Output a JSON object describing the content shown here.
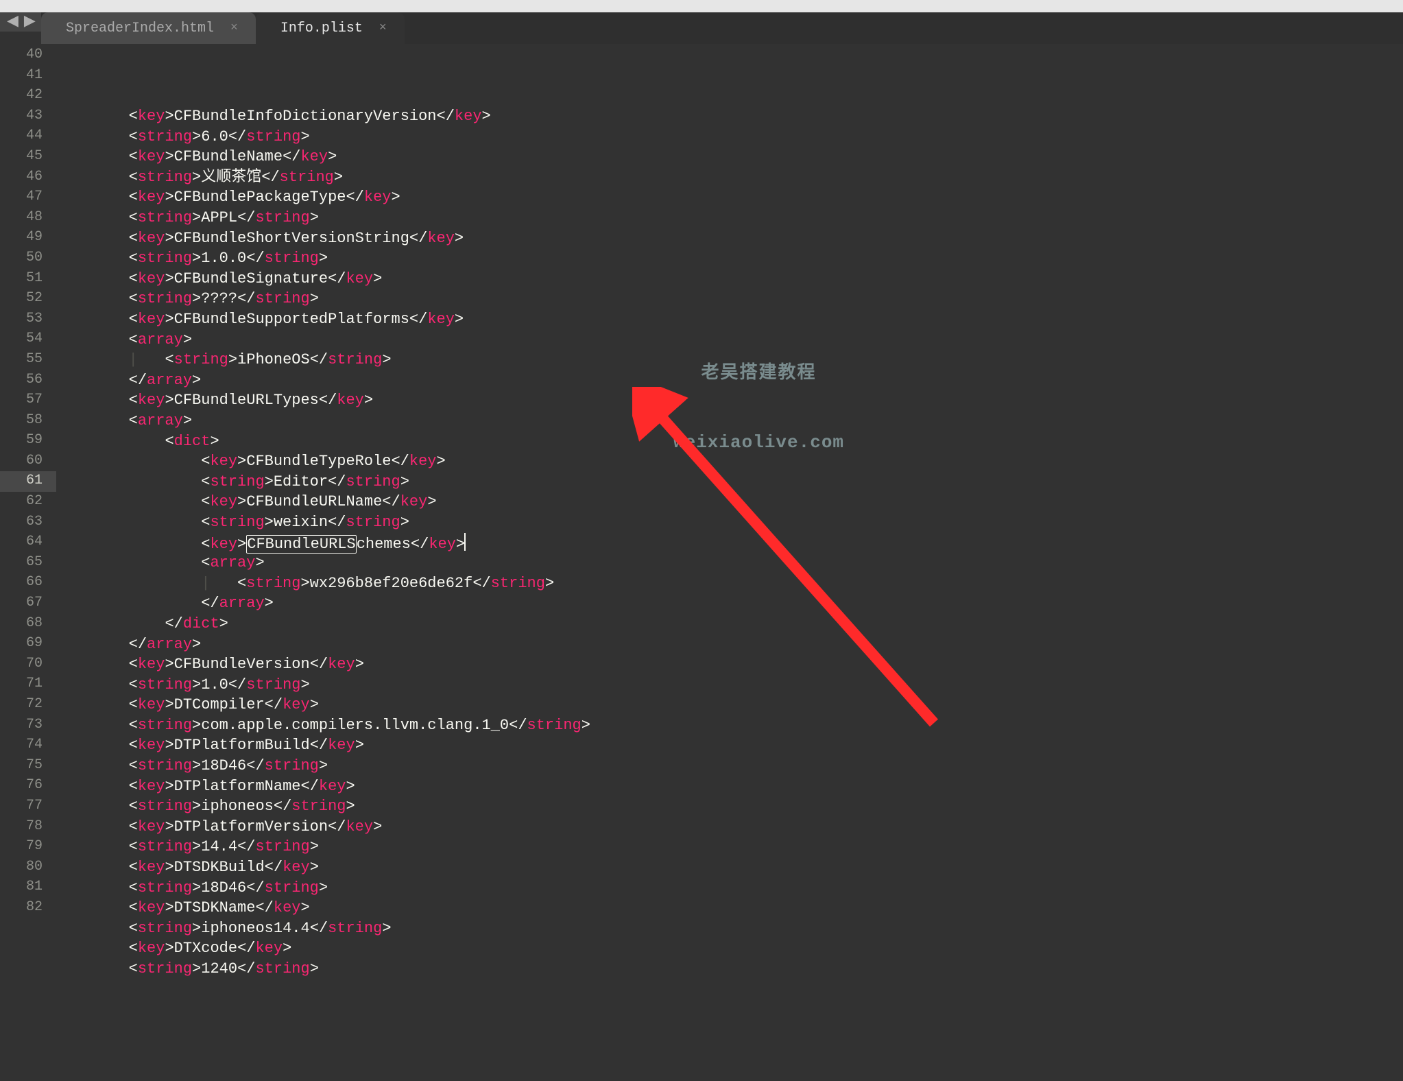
{
  "tabs": [
    {
      "label": "SpreaderIndex.html",
      "active": false
    },
    {
      "label": "Info.plist",
      "active": true
    }
  ],
  "watermark": {
    "line1": "老吴搭建教程",
    "line2": "weixiaolive.com"
  },
  "gutter": {
    "start": 40,
    "end": 82,
    "highlight": 61
  },
  "boxed_text": "CFBundleURLS",
  "lines": [
    {
      "n": 40,
      "indent": 2,
      "tokens": [
        [
          "p",
          "<"
        ],
        [
          "t",
          "key"
        ],
        [
          "p",
          ">"
        ],
        [
          "tx",
          "CFBundleInfoDictionaryVersion"
        ],
        [
          "p",
          "</"
        ],
        [
          "t",
          "key"
        ],
        [
          "p",
          ">"
        ]
      ]
    },
    {
      "n": 41,
      "indent": 2,
      "tokens": [
        [
          "p",
          "<"
        ],
        [
          "t",
          "string"
        ],
        [
          "p",
          ">"
        ],
        [
          "tx",
          "6.0"
        ],
        [
          "p",
          "</"
        ],
        [
          "t",
          "string"
        ],
        [
          "p",
          ">"
        ]
      ]
    },
    {
      "n": 42,
      "indent": 2,
      "tokens": [
        [
          "p",
          "<"
        ],
        [
          "t",
          "key"
        ],
        [
          "p",
          ">"
        ],
        [
          "tx",
          "CFBundleName"
        ],
        [
          "p",
          "</"
        ],
        [
          "t",
          "key"
        ],
        [
          "p",
          ">"
        ]
      ]
    },
    {
      "n": 43,
      "indent": 2,
      "tokens": [
        [
          "p",
          "<"
        ],
        [
          "t",
          "string"
        ],
        [
          "p",
          ">"
        ],
        [
          "tx",
          "义顺茶馆"
        ],
        [
          "p",
          "</"
        ],
        [
          "t",
          "string"
        ],
        [
          "p",
          ">"
        ]
      ]
    },
    {
      "n": 44,
      "indent": 2,
      "tokens": [
        [
          "p",
          "<"
        ],
        [
          "t",
          "key"
        ],
        [
          "p",
          ">"
        ],
        [
          "tx",
          "CFBundlePackageType"
        ],
        [
          "p",
          "</"
        ],
        [
          "t",
          "key"
        ],
        [
          "p",
          ">"
        ]
      ]
    },
    {
      "n": 45,
      "indent": 2,
      "tokens": [
        [
          "p",
          "<"
        ],
        [
          "t",
          "string"
        ],
        [
          "p",
          ">"
        ],
        [
          "tx",
          "APPL"
        ],
        [
          "p",
          "</"
        ],
        [
          "t",
          "string"
        ],
        [
          "p",
          ">"
        ]
      ]
    },
    {
      "n": 46,
      "indent": 2,
      "tokens": [
        [
          "p",
          "<"
        ],
        [
          "t",
          "key"
        ],
        [
          "p",
          ">"
        ],
        [
          "tx",
          "CFBundleShortVersionString"
        ],
        [
          "p",
          "</"
        ],
        [
          "t",
          "key"
        ],
        [
          "p",
          ">"
        ]
      ]
    },
    {
      "n": 47,
      "indent": 2,
      "tokens": [
        [
          "p",
          "<"
        ],
        [
          "t",
          "string"
        ],
        [
          "p",
          ">"
        ],
        [
          "tx",
          "1.0.0"
        ],
        [
          "p",
          "</"
        ],
        [
          "t",
          "string"
        ],
        [
          "p",
          ">"
        ]
      ]
    },
    {
      "n": 48,
      "indent": 2,
      "tokens": [
        [
          "p",
          "<"
        ],
        [
          "t",
          "key"
        ],
        [
          "p",
          ">"
        ],
        [
          "tx",
          "CFBundleSignature"
        ],
        [
          "p",
          "</"
        ],
        [
          "t",
          "key"
        ],
        [
          "p",
          ">"
        ]
      ]
    },
    {
      "n": 49,
      "indent": 2,
      "tokens": [
        [
          "p",
          "<"
        ],
        [
          "t",
          "string"
        ],
        [
          "p",
          ">"
        ],
        [
          "tx",
          "????"
        ],
        [
          "p",
          "</"
        ],
        [
          "t",
          "string"
        ],
        [
          "p",
          ">"
        ]
      ]
    },
    {
      "n": 50,
      "indent": 2,
      "tokens": [
        [
          "p",
          "<"
        ],
        [
          "t",
          "key"
        ],
        [
          "p",
          ">"
        ],
        [
          "tx",
          "CFBundleSupportedPlatforms"
        ],
        [
          "p",
          "</"
        ],
        [
          "t",
          "key"
        ],
        [
          "p",
          ">"
        ]
      ]
    },
    {
      "n": 51,
      "indent": 2,
      "tokens": [
        [
          "p",
          "<"
        ],
        [
          "t",
          "array"
        ],
        [
          "p",
          ">"
        ]
      ]
    },
    {
      "n": 52,
      "indent": 3,
      "guide": true,
      "tokens": [
        [
          "p",
          "<"
        ],
        [
          "t",
          "string"
        ],
        [
          "p",
          ">"
        ],
        [
          "tx",
          "iPhoneOS"
        ],
        [
          "p",
          "</"
        ],
        [
          "t",
          "string"
        ],
        [
          "p",
          ">"
        ]
      ]
    },
    {
      "n": 53,
      "indent": 2,
      "tokens": [
        [
          "p",
          "</"
        ],
        [
          "t",
          "array"
        ],
        [
          "p",
          ">"
        ]
      ]
    },
    {
      "n": 54,
      "indent": 2,
      "tokens": [
        [
          "p",
          "<"
        ],
        [
          "t",
          "key"
        ],
        [
          "p",
          ">"
        ],
        [
          "tx",
          "CFBundleURLTypes"
        ],
        [
          "p",
          "</"
        ],
        [
          "t",
          "key"
        ],
        [
          "p",
          ">"
        ]
      ]
    },
    {
      "n": 55,
      "indent": 2,
      "tokens": [
        [
          "p",
          "<"
        ],
        [
          "t",
          "array"
        ],
        [
          "p",
          ">"
        ]
      ]
    },
    {
      "n": 56,
      "indent": 3,
      "tokens": [
        [
          "p",
          "<"
        ],
        [
          "t",
          "dict"
        ],
        [
          "p",
          ">"
        ]
      ]
    },
    {
      "n": 57,
      "indent": 4,
      "tokens": [
        [
          "p",
          "<"
        ],
        [
          "t",
          "key"
        ],
        [
          "p",
          ">"
        ],
        [
          "tx",
          "CFBundleTypeRole"
        ],
        [
          "p",
          "</"
        ],
        [
          "t",
          "key"
        ],
        [
          "p",
          ">"
        ]
      ]
    },
    {
      "n": 58,
      "indent": 4,
      "tokens": [
        [
          "p",
          "<"
        ],
        [
          "t",
          "string"
        ],
        [
          "p",
          ">"
        ],
        [
          "tx",
          "Editor"
        ],
        [
          "p",
          "</"
        ],
        [
          "t",
          "string"
        ],
        [
          "p",
          ">"
        ]
      ]
    },
    {
      "n": 59,
      "indent": 4,
      "tokens": [
        [
          "p",
          "<"
        ],
        [
          "t",
          "key"
        ],
        [
          "p",
          ">"
        ],
        [
          "tx",
          "CFBundleURLName"
        ],
        [
          "p",
          "</"
        ],
        [
          "t",
          "key"
        ],
        [
          "p",
          ">"
        ]
      ]
    },
    {
      "n": 60,
      "indent": 4,
      "tokens": [
        [
          "p",
          "<"
        ],
        [
          "t",
          "string"
        ],
        [
          "p",
          ">"
        ],
        [
          "tx",
          "weixin"
        ],
        [
          "p",
          "</"
        ],
        [
          "t",
          "string"
        ],
        [
          "p",
          ">"
        ]
      ]
    },
    {
      "n": 61,
      "indent": 4,
      "tokens": [
        [
          "p",
          "<"
        ],
        [
          "t",
          "key"
        ],
        [
          "p",
          ">"
        ],
        [
          "boxed",
          "CFBundleURLS"
        ],
        [
          "tx",
          "chemes"
        ],
        [
          "p",
          "</"
        ],
        [
          "t",
          "key"
        ],
        [
          "p",
          ">"
        ],
        [
          "cursor",
          ""
        ]
      ]
    },
    {
      "n": 62,
      "indent": 4,
      "tokens": [
        [
          "p",
          "<"
        ],
        [
          "t",
          "array"
        ],
        [
          "p",
          ">"
        ]
      ]
    },
    {
      "n": 63,
      "indent": 5,
      "guide": true,
      "tokens": [
        [
          "p",
          "<"
        ],
        [
          "t",
          "string"
        ],
        [
          "p",
          ">"
        ],
        [
          "tx",
          "wx296b8ef20e6de62f"
        ],
        [
          "p",
          "</"
        ],
        [
          "t",
          "string"
        ],
        [
          "p",
          ">"
        ]
      ]
    },
    {
      "n": 64,
      "indent": 4,
      "tokens": [
        [
          "p",
          "</"
        ],
        [
          "t",
          "array"
        ],
        [
          "p",
          ">"
        ]
      ]
    },
    {
      "n": 65,
      "indent": 3,
      "tokens": [
        [
          "p",
          "</"
        ],
        [
          "t",
          "dict"
        ],
        [
          "p",
          ">"
        ]
      ]
    },
    {
      "n": 66,
      "indent": 2,
      "tokens": [
        [
          "p",
          "</"
        ],
        [
          "t",
          "array"
        ],
        [
          "p",
          ">"
        ]
      ]
    },
    {
      "n": 67,
      "indent": 2,
      "tokens": [
        [
          "p",
          "<"
        ],
        [
          "t",
          "key"
        ],
        [
          "p",
          ">"
        ],
        [
          "tx",
          "CFBundleVersion"
        ],
        [
          "p",
          "</"
        ],
        [
          "t",
          "key"
        ],
        [
          "p",
          ">"
        ]
      ]
    },
    {
      "n": 68,
      "indent": 2,
      "tokens": [
        [
          "p",
          "<"
        ],
        [
          "t",
          "string"
        ],
        [
          "p",
          ">"
        ],
        [
          "tx",
          "1.0"
        ],
        [
          "p",
          "</"
        ],
        [
          "t",
          "string"
        ],
        [
          "p",
          ">"
        ]
      ]
    },
    {
      "n": 69,
      "indent": 2,
      "tokens": [
        [
          "p",
          "<"
        ],
        [
          "t",
          "key"
        ],
        [
          "p",
          ">"
        ],
        [
          "tx",
          "DTCompiler"
        ],
        [
          "p",
          "</"
        ],
        [
          "t",
          "key"
        ],
        [
          "p",
          ">"
        ]
      ]
    },
    {
      "n": 70,
      "indent": 2,
      "tokens": [
        [
          "p",
          "<"
        ],
        [
          "t",
          "string"
        ],
        [
          "p",
          ">"
        ],
        [
          "tx",
          "com.apple.compilers.llvm.clang.1_0"
        ],
        [
          "p",
          "</"
        ],
        [
          "t",
          "string"
        ],
        [
          "p",
          ">"
        ]
      ]
    },
    {
      "n": 71,
      "indent": 2,
      "tokens": [
        [
          "p",
          "<"
        ],
        [
          "t",
          "key"
        ],
        [
          "p",
          ">"
        ],
        [
          "tx",
          "DTPlatformBuild"
        ],
        [
          "p",
          "</"
        ],
        [
          "t",
          "key"
        ],
        [
          "p",
          ">"
        ]
      ]
    },
    {
      "n": 72,
      "indent": 2,
      "tokens": [
        [
          "p",
          "<"
        ],
        [
          "t",
          "string"
        ],
        [
          "p",
          ">"
        ],
        [
          "tx",
          "18D46"
        ],
        [
          "p",
          "</"
        ],
        [
          "t",
          "string"
        ],
        [
          "p",
          ">"
        ]
      ]
    },
    {
      "n": 73,
      "indent": 2,
      "tokens": [
        [
          "p",
          "<"
        ],
        [
          "t",
          "key"
        ],
        [
          "p",
          ">"
        ],
        [
          "tx",
          "DTPlatformName"
        ],
        [
          "p",
          "</"
        ],
        [
          "t",
          "key"
        ],
        [
          "p",
          ">"
        ]
      ]
    },
    {
      "n": 74,
      "indent": 2,
      "tokens": [
        [
          "p",
          "<"
        ],
        [
          "t",
          "string"
        ],
        [
          "p",
          ">"
        ],
        [
          "tx",
          "iphoneos"
        ],
        [
          "p",
          "</"
        ],
        [
          "t",
          "string"
        ],
        [
          "p",
          ">"
        ]
      ]
    },
    {
      "n": 75,
      "indent": 2,
      "tokens": [
        [
          "p",
          "<"
        ],
        [
          "t",
          "key"
        ],
        [
          "p",
          ">"
        ],
        [
          "tx",
          "DTPlatformVersion"
        ],
        [
          "p",
          "</"
        ],
        [
          "t",
          "key"
        ],
        [
          "p",
          ">"
        ]
      ]
    },
    {
      "n": 76,
      "indent": 2,
      "tokens": [
        [
          "p",
          "<"
        ],
        [
          "t",
          "string"
        ],
        [
          "p",
          ">"
        ],
        [
          "tx",
          "14.4"
        ],
        [
          "p",
          "</"
        ],
        [
          "t",
          "string"
        ],
        [
          "p",
          ">"
        ]
      ]
    },
    {
      "n": 77,
      "indent": 2,
      "tokens": [
        [
          "p",
          "<"
        ],
        [
          "t",
          "key"
        ],
        [
          "p",
          ">"
        ],
        [
          "tx",
          "DTSDKBuild"
        ],
        [
          "p",
          "</"
        ],
        [
          "t",
          "key"
        ],
        [
          "p",
          ">"
        ]
      ]
    },
    {
      "n": 78,
      "indent": 2,
      "tokens": [
        [
          "p",
          "<"
        ],
        [
          "t",
          "string"
        ],
        [
          "p",
          ">"
        ],
        [
          "tx",
          "18D46"
        ],
        [
          "p",
          "</"
        ],
        [
          "t",
          "string"
        ],
        [
          "p",
          ">"
        ]
      ]
    },
    {
      "n": 79,
      "indent": 2,
      "tokens": [
        [
          "p",
          "<"
        ],
        [
          "t",
          "key"
        ],
        [
          "p",
          ">"
        ],
        [
          "tx",
          "DTSDKName"
        ],
        [
          "p",
          "</"
        ],
        [
          "t",
          "key"
        ],
        [
          "p",
          ">"
        ]
      ]
    },
    {
      "n": 80,
      "indent": 2,
      "tokens": [
        [
          "p",
          "<"
        ],
        [
          "t",
          "string"
        ],
        [
          "p",
          ">"
        ],
        [
          "tx",
          "iphoneos14.4"
        ],
        [
          "p",
          "</"
        ],
        [
          "t",
          "string"
        ],
        [
          "p",
          ">"
        ]
      ]
    },
    {
      "n": 81,
      "indent": 2,
      "tokens": [
        [
          "p",
          "<"
        ],
        [
          "t",
          "key"
        ],
        [
          "p",
          ">"
        ],
        [
          "tx",
          "DTXcode"
        ],
        [
          "p",
          "</"
        ],
        [
          "t",
          "key"
        ],
        [
          "p",
          ">"
        ]
      ]
    },
    {
      "n": 82,
      "indent": 2,
      "tokens": [
        [
          "p",
          "<"
        ],
        [
          "t",
          "string"
        ],
        [
          "p",
          ">"
        ],
        [
          "tx",
          "1240"
        ],
        [
          "p",
          "</"
        ],
        [
          "t",
          "string"
        ],
        [
          "p",
          ">"
        ]
      ]
    }
  ]
}
